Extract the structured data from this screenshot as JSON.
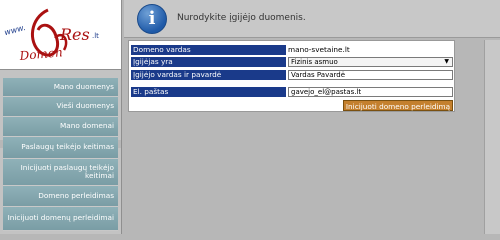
{
  "logo": {
    "text": "Res",
    "sub_text": "www.",
    "domain_text": "Domen",
    "tld_text": ".lt"
  },
  "header": {
    "icon": "info-icon",
    "message": "Nurodykite įgijėjo duomenis."
  },
  "sidebar": {
    "items": [
      {
        "label": "Mano duomenys"
      },
      {
        "label": "Vieši duomenys"
      },
      {
        "label": "Mano domenai"
      },
      {
        "label": "Paslaugų teikėjo keitimas"
      },
      {
        "label": "Inicijuoti paslaugų teikėjo keitimai"
      },
      {
        "label": "Domeno perleidimas"
      },
      {
        "label": "Inicijuoti domenų perleidimai"
      }
    ]
  },
  "form": {
    "domain_label": "Domeno vardas",
    "domain_value": "mano-svetaine.lt",
    "acquirer_type_label": "Įgijėjas yra",
    "acquirer_type_value": "Fizinis asmuo",
    "acquirer_name_label": "Įgijėjo vardas ir pavardė",
    "acquirer_name_value": "Vardas Pavardė",
    "email_label": "El. paštas",
    "email_value": "gavejo_el@pastas.lt",
    "submit_label": "Inicijuoti domeno perleidimą"
  },
  "colors": {
    "label_bg": "#1a3a8a",
    "menu_bg": "#86a8b0",
    "submit_bg": "#c4802e"
  }
}
